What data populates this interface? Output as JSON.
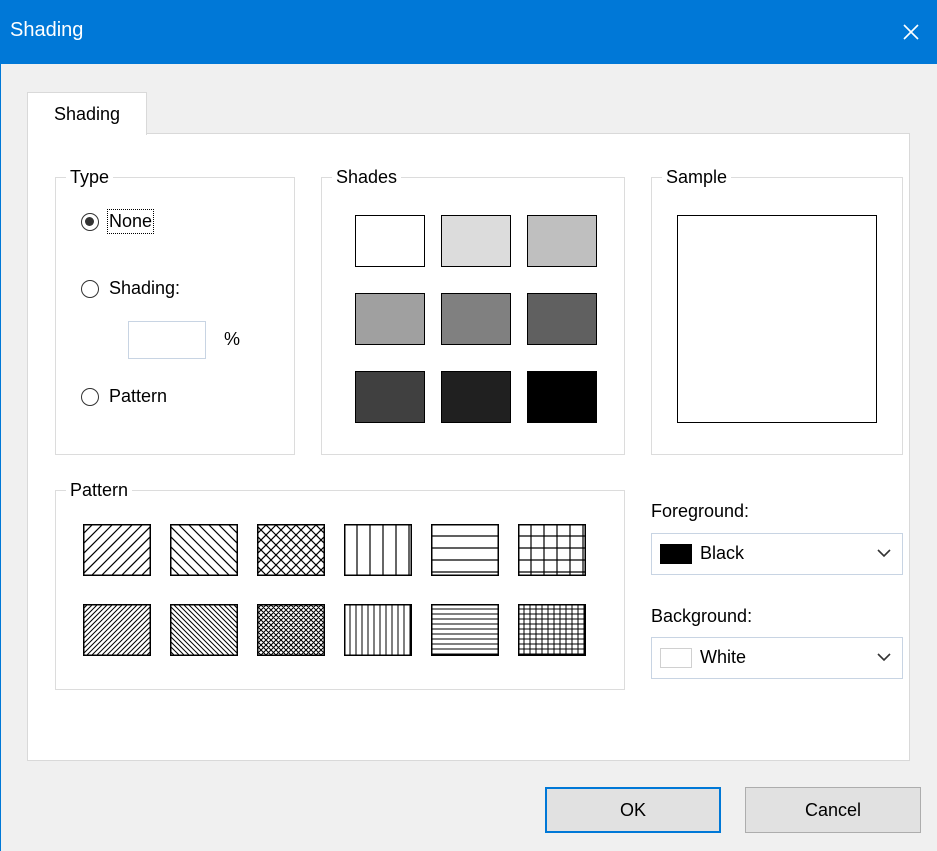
{
  "window": {
    "title": "Shading",
    "close_icon": "close-icon"
  },
  "tabs": [
    {
      "label": "Shading",
      "selected": true
    }
  ],
  "type_group": {
    "label": "Type",
    "options": [
      {
        "label": "None",
        "checked": true
      },
      {
        "label": "Shading:",
        "checked": false
      },
      {
        "label": "Pattern",
        "checked": false
      }
    ],
    "percent_value": "",
    "percent_unit": "%"
  },
  "shades_group": {
    "label": "Shades",
    "swatches": [
      "#ffffff",
      "#dcdcdc",
      "#bfbfbf",
      "#a0a0a0",
      "#808080",
      "#606060",
      "#404040",
      "#202020",
      "#000000"
    ]
  },
  "sample_group": {
    "label": "Sample",
    "fill": "#ffffff"
  },
  "pattern_group": {
    "label": "Pattern",
    "patterns": [
      "wide-up-diagonal",
      "wide-down-diagonal",
      "wide-diagonal-cross",
      "wide-vertical",
      "wide-horizontal",
      "wide-grid",
      "narrow-up-diagonal",
      "narrow-down-diagonal",
      "narrow-diagonal-cross",
      "narrow-vertical",
      "narrow-horizontal",
      "narrow-grid"
    ]
  },
  "foreground": {
    "label": "Foreground:",
    "value": "Black",
    "swatch": "#000000"
  },
  "background": {
    "label": "Background:",
    "value": "White",
    "swatch": "#ffffff"
  },
  "buttons": {
    "ok": "OK",
    "cancel": "Cancel"
  },
  "colors": {
    "titlebar": "#0078d7",
    "accent": "#0078d7"
  }
}
